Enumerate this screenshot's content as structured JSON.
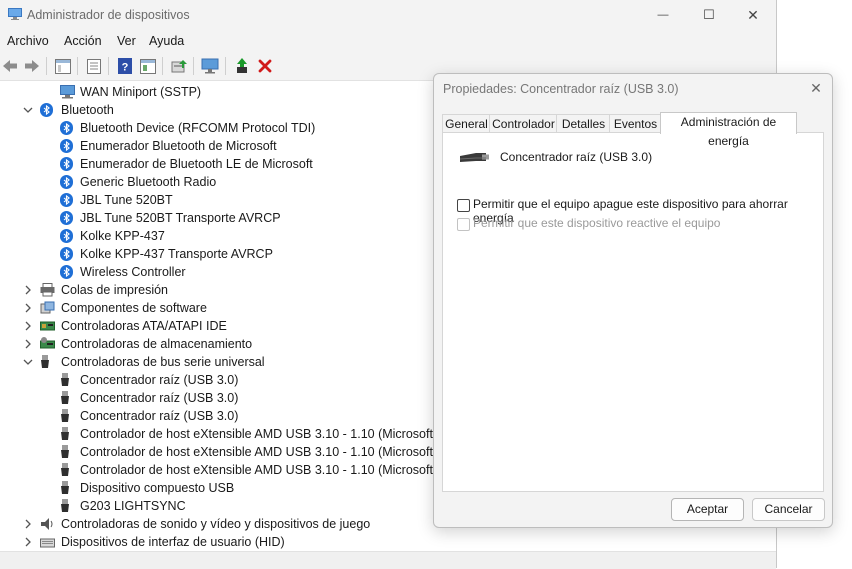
{
  "window": {
    "title": "Administrador de dispositivos",
    "minimize": "—",
    "maximize": "☐",
    "close": "✕"
  },
  "menu": [
    "Archivo",
    "Acción",
    "Ver",
    "Ayuda"
  ],
  "tree": {
    "items": [
      {
        "label": "WAN Miniport (SSTP)",
        "level": 2,
        "icon": "network-adapter-icon"
      },
      {
        "label": "Bluetooth",
        "level": 1,
        "icon": "bluetooth-icon",
        "expanded": true
      },
      {
        "label": "Bluetooth Device (RFCOMM Protocol TDI)",
        "level": 2,
        "icon": "bluetooth-icon"
      },
      {
        "label": "Enumerador Bluetooth de Microsoft",
        "level": 2,
        "icon": "bluetooth-icon"
      },
      {
        "label": "Enumerador de Bluetooth LE de Microsoft",
        "level": 2,
        "icon": "bluetooth-icon"
      },
      {
        "label": "Generic Bluetooth Radio",
        "level": 2,
        "icon": "bluetooth-icon"
      },
      {
        "label": "JBL Tune 520BT",
        "level": 2,
        "icon": "bluetooth-icon"
      },
      {
        "label": "JBL Tune 520BT Transporte AVRCP",
        "level": 2,
        "icon": "bluetooth-icon"
      },
      {
        "label": "Kolke KPP-437",
        "level": 2,
        "icon": "bluetooth-icon"
      },
      {
        "label": "Kolke KPP-437 Transporte AVRCP",
        "level": 2,
        "icon": "bluetooth-icon"
      },
      {
        "label": "Wireless Controller",
        "level": 2,
        "icon": "bluetooth-icon"
      },
      {
        "label": "Colas de impresión",
        "level": 1,
        "icon": "printer-icon",
        "expanded": false
      },
      {
        "label": "Componentes de software",
        "level": 1,
        "icon": "software-component-icon",
        "expanded": false
      },
      {
        "label": "Controladoras ATA/ATAPI IDE",
        "level": 1,
        "icon": "ide-controller-icon",
        "expanded": false
      },
      {
        "label": "Controladoras de almacenamiento",
        "level": 1,
        "icon": "storage-controller-icon",
        "expanded": false
      },
      {
        "label": "Controladoras de bus serie universal",
        "level": 1,
        "icon": "usb-icon",
        "expanded": true
      },
      {
        "label": "Concentrador raíz (USB 3.0)",
        "level": 2,
        "icon": "usb-icon"
      },
      {
        "label": "Concentrador raíz (USB 3.0)",
        "level": 2,
        "icon": "usb-icon"
      },
      {
        "label": "Concentrador raíz (USB 3.0)",
        "level": 2,
        "icon": "usb-icon"
      },
      {
        "label": "Controlador de host eXtensible AMD USB 3.10 - 1.10 (Microsoft)",
        "level": 2,
        "icon": "usb-icon"
      },
      {
        "label": "Controlador de host eXtensible AMD USB 3.10 - 1.10 (Microsoft)",
        "level": 2,
        "icon": "usb-icon"
      },
      {
        "label": "Controlador de host eXtensible AMD USB 3.10 - 1.10 (Microsoft)",
        "level": 2,
        "icon": "usb-icon"
      },
      {
        "label": "Dispositivo compuesto USB",
        "level": 2,
        "icon": "usb-icon"
      },
      {
        "label": "G203 LIGHTSYNC",
        "level": 2,
        "icon": "usb-icon"
      },
      {
        "label": "Controladoras de sonido y vídeo y dispositivos de juego",
        "level": 1,
        "icon": "speaker-icon",
        "expanded": false
      },
      {
        "label": "Dispositivos de interfaz de usuario (HID)",
        "level": 1,
        "icon": "hid-icon",
        "expanded": false
      }
    ]
  },
  "dialog": {
    "title": "Propiedades: Concentrador raíz (USB 3.0)",
    "close": "✕",
    "tabs": [
      "General",
      "Controlador",
      "Detalles",
      "Eventos",
      "Administración de energía"
    ],
    "active_tab": "Administración de energía",
    "device_name": "Concentrador raíz (USB 3.0)",
    "checkbox1": "Permitir que el equipo apague este dispositivo para ahorrar energía",
    "checkbox2": "Permitir que este dispositivo reactive el equipo",
    "ok": "Aceptar",
    "cancel": "Cancelar"
  },
  "colors": {
    "accent": "#1f6fd6",
    "titlebar": "#f3f3f3",
    "delete_red": "#d11a1a",
    "enable_green": "#1a9a2a"
  }
}
